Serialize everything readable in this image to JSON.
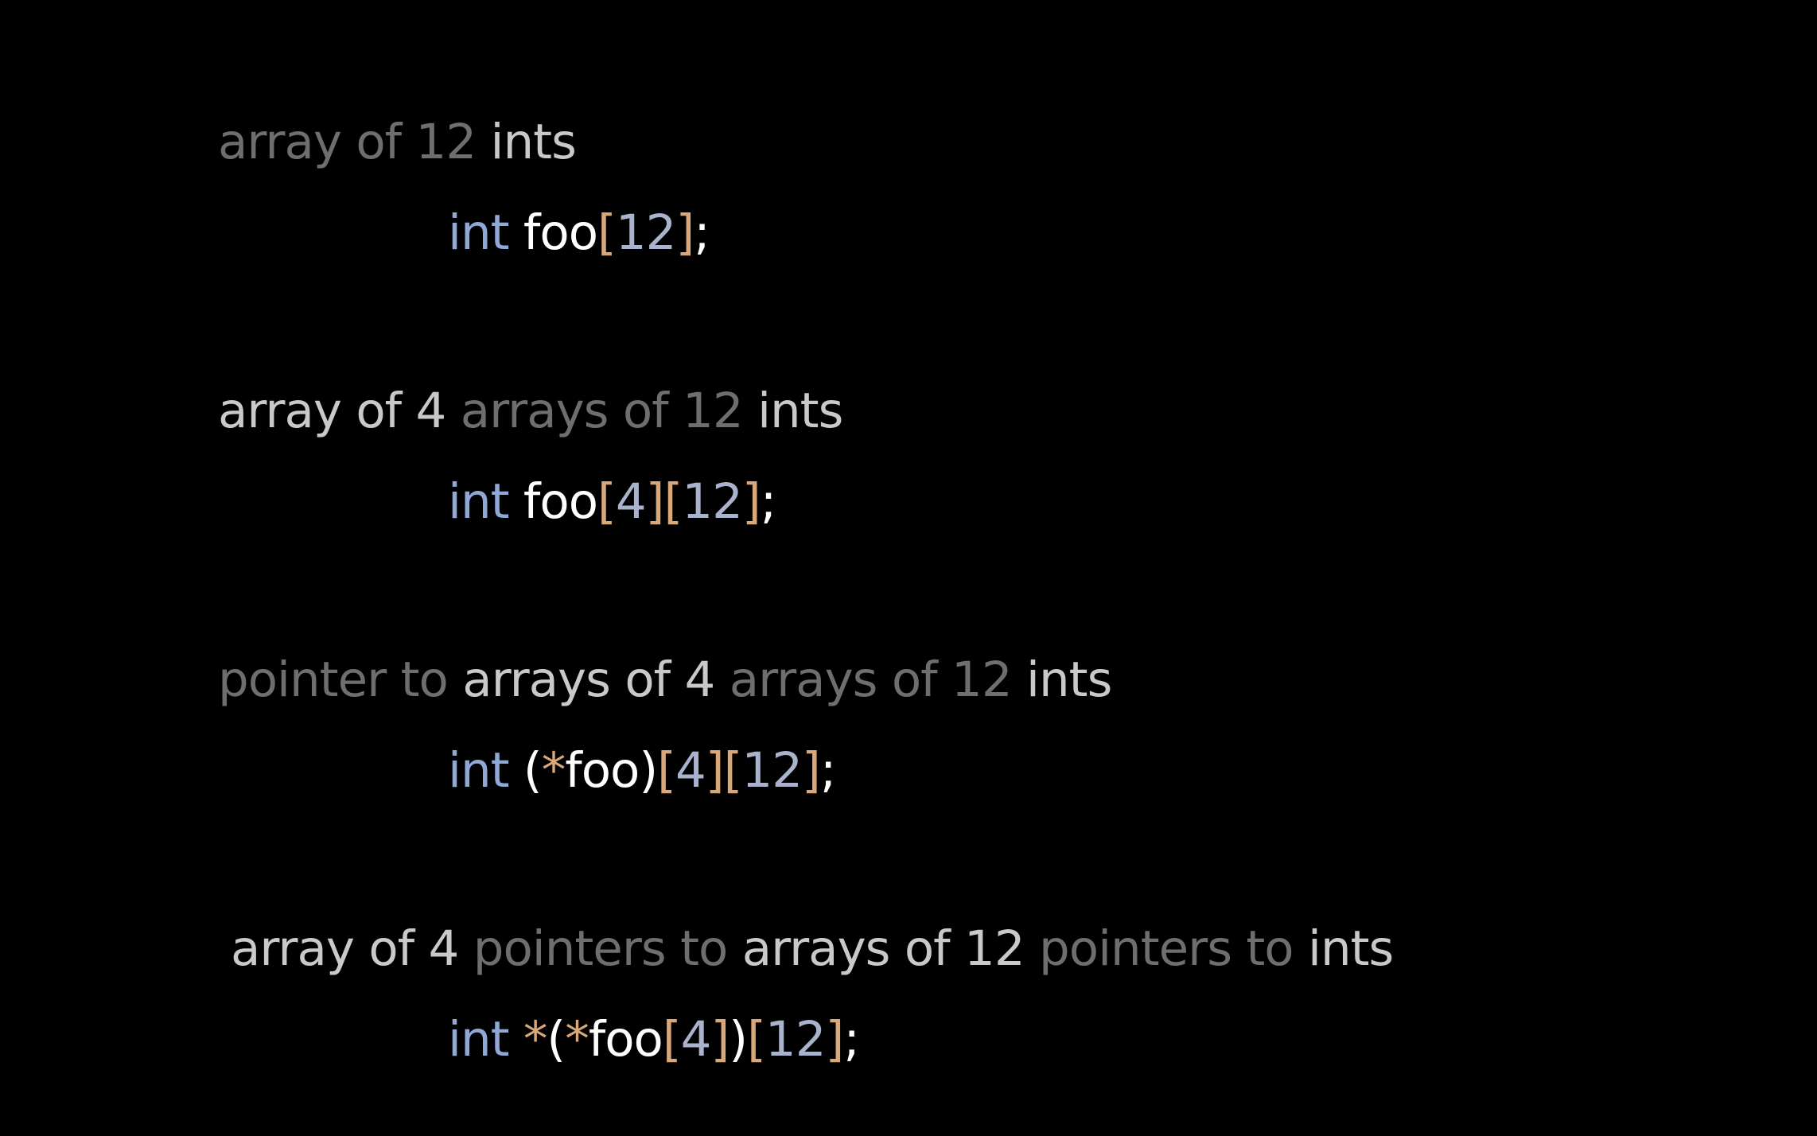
{
  "examples": [
    {
      "description": [
        {
          "text": "array of 12 ",
          "tone": "dim"
        },
        {
          "text": "ints",
          "tone": "lite"
        }
      ],
      "code": [
        {
          "text": "int",
          "tone": "kw"
        },
        {
          "text": " ",
          "tone": "punc"
        },
        {
          "text": "foo",
          "tone": "id"
        },
        {
          "text": "[",
          "tone": "br"
        },
        {
          "text": "12",
          "tone": "num"
        },
        {
          "text": "]",
          "tone": "br"
        },
        {
          "text": ";",
          "tone": "punc"
        }
      ]
    },
    {
      "description": [
        {
          "text": "array of 4 ",
          "tone": "lite"
        },
        {
          "text": "arrays of 12 ",
          "tone": "dim"
        },
        {
          "text": "ints",
          "tone": "lite"
        }
      ],
      "code": [
        {
          "text": "int",
          "tone": "kw"
        },
        {
          "text": " ",
          "tone": "punc"
        },
        {
          "text": "foo",
          "tone": "id"
        },
        {
          "text": "[",
          "tone": "br"
        },
        {
          "text": "4",
          "tone": "num"
        },
        {
          "text": "]",
          "tone": "br"
        },
        {
          "text": "[",
          "tone": "br"
        },
        {
          "text": "12",
          "tone": "num"
        },
        {
          "text": "]",
          "tone": "br"
        },
        {
          "text": ";",
          "tone": "punc"
        }
      ]
    },
    {
      "description": [
        {
          "text": "pointer to ",
          "tone": "dim"
        },
        {
          "text": "arrays of 4 ",
          "tone": "lite"
        },
        {
          "text": "arrays of 12 ",
          "tone": "dim"
        },
        {
          "text": "ints",
          "tone": "lite"
        }
      ],
      "code": [
        {
          "text": "int",
          "tone": "kw"
        },
        {
          "text": " ",
          "tone": "punc"
        },
        {
          "text": "(",
          "tone": "id"
        },
        {
          "text": "*",
          "tone": "star"
        },
        {
          "text": "foo",
          "tone": "id"
        },
        {
          "text": ")",
          "tone": "id"
        },
        {
          "text": "[",
          "tone": "br"
        },
        {
          "text": "4",
          "tone": "num"
        },
        {
          "text": "]",
          "tone": "br"
        },
        {
          "text": "[",
          "tone": "br"
        },
        {
          "text": "12",
          "tone": "num"
        },
        {
          "text": "]",
          "tone": "br"
        },
        {
          "text": ";",
          "tone": "punc"
        }
      ]
    },
    {
      "description": [
        {
          "text": "array of 4 ",
          "tone": "lite"
        },
        {
          "text": "pointers to ",
          "tone": "dim"
        },
        {
          "text": "arrays of 12 ",
          "tone": "lite"
        },
        {
          "text": "pointers to ",
          "tone": "dim"
        },
        {
          "text": "ints",
          "tone": "lite"
        }
      ],
      "code": [
        {
          "text": "int",
          "tone": "kw"
        },
        {
          "text": " ",
          "tone": "punc"
        },
        {
          "text": "*",
          "tone": "star"
        },
        {
          "text": "(",
          "tone": "id"
        },
        {
          "text": "*",
          "tone": "star"
        },
        {
          "text": "foo",
          "tone": "id"
        },
        {
          "text": "[",
          "tone": "br"
        },
        {
          "text": "4",
          "tone": "num"
        },
        {
          "text": "]",
          "tone": "br"
        },
        {
          "text": ")",
          "tone": "id"
        },
        {
          "text": "[",
          "tone": "br"
        },
        {
          "text": "12",
          "tone": "num"
        },
        {
          "text": "]",
          "tone": "br"
        },
        {
          "text": ";",
          "tone": "punc"
        }
      ]
    }
  ],
  "colors": {
    "background": "#000000",
    "dim_text": "#6e6e6e",
    "light_text": "#c9c9c9",
    "keyword": "#8fa8d6",
    "identifier": "#ffffff",
    "bracket": "#d9a87a",
    "number": "#a9b4cc"
  }
}
